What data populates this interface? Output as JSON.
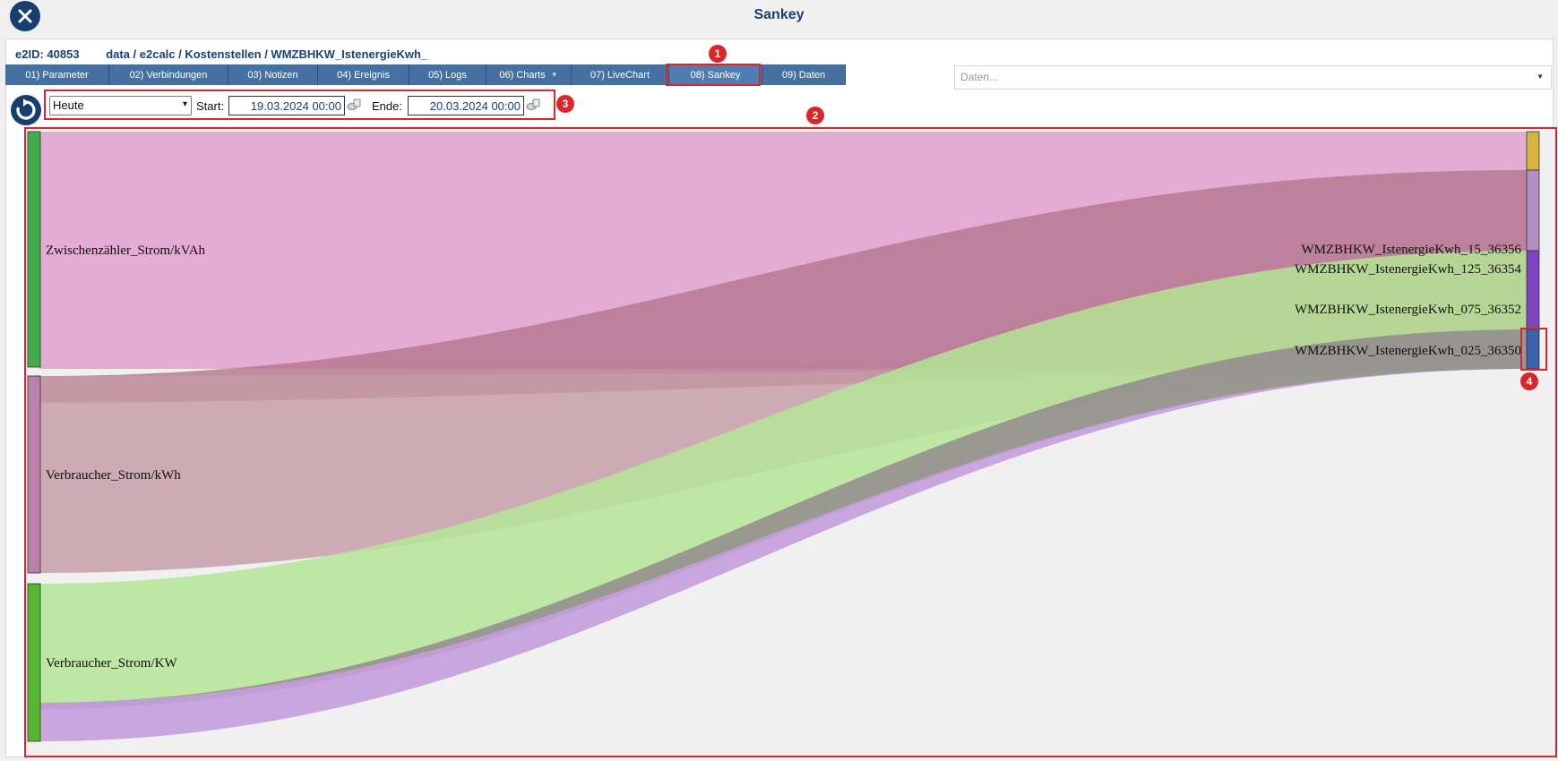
{
  "header": {
    "title": "Sankey"
  },
  "breadcrumb": {
    "eid": "e2ID: 40853",
    "path": "data / e2calc / Kostenstellen / WMZBHKW_IstenergieKwh_"
  },
  "tabs": [
    {
      "label": "01) Parameter"
    },
    {
      "label": "02) Verbindungen"
    },
    {
      "label": "03) Notizen"
    },
    {
      "label": "04) Ereignis"
    },
    {
      "label": "05) Logs"
    },
    {
      "label": "06) Charts"
    },
    {
      "label": "07) LiveChart"
    },
    {
      "label": "08) Sankey",
      "active": true
    },
    {
      "label": "09) Daten"
    }
  ],
  "daten_select": {
    "placeholder": "Daten..."
  },
  "controls": {
    "period": "Heute",
    "start_label": "Start:",
    "start_value": "19.03.2024 00:00",
    "end_label": "Ende:",
    "end_value": "20.03.2024 00:00"
  },
  "annotations": [
    "1",
    "2",
    "3",
    "4"
  ],
  "sankey": {
    "source_nodes": [
      {
        "name": "Zwischenzähler_Strom/kVAh",
        "color": "#3fae49"
      },
      {
        "name": "Verbraucher_Strom/kWh",
        "color": "#b982a8"
      },
      {
        "name": "Verbraucher_Strom/KW",
        "color": "#56b82e"
      }
    ],
    "target_nodes": [
      {
        "name": "WMZBHKW_IstenergieKwh_15_36356",
        "color": "#d6b33c"
      },
      {
        "name": "WMZBHKW_IstenergieKwh_125_36354",
        "color": "#b38fc3"
      },
      {
        "name": "WMZBHKW_IstenergieKwh_075_36352",
        "color": "#7d45bf"
      },
      {
        "name": "WMZBHKW_IstenergieKwh_025_36350",
        "color": "#3c62ad"
      }
    ],
    "link_colors": {
      "source_1": "#e0a0cc",
      "source_2": "#b4788f",
      "source_3": "#b5e595",
      "flow_dark": "#8c7f8c",
      "flow_purple": "#c49ddc"
    },
    "background": "#f0f0f0"
  }
}
